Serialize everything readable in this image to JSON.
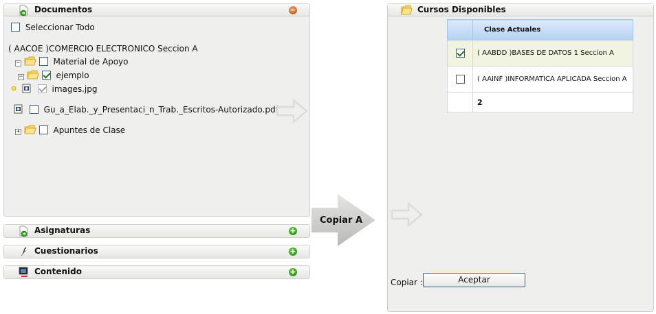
{
  "documents": {
    "title": "Documentos",
    "select_all": "Seleccionar Todo",
    "course_title": "( AACOE )COMERCIO ELECTRONICO Seccion A",
    "tree": [
      {
        "label": "Material de Apoyo",
        "expander": "−",
        "checked": false
      },
      {
        "label": "ejemplo",
        "expander": "−",
        "checked": true
      },
      {
        "label": "images.jpg",
        "checked": true,
        "disabled": true
      },
      {
        "label": "Gu_a_Elab._y_Presentaci_n_Trab._Escritos-Autorizado.pdf",
        "checked": false
      },
      {
        "label": "Apuntes de Clase",
        "expander": "+",
        "checked": false
      }
    ]
  },
  "sections": [
    {
      "title": "Asignaturas",
      "icon": "subjects-icon"
    },
    {
      "title": "Cuestionarios",
      "icon": "quiz-icon"
    },
    {
      "title": "Contenido",
      "icon": "content-icon"
    }
  ],
  "copy_button_label": "Copiar A",
  "courses": {
    "title": "Cursos Disponibles",
    "column_header": "Clase Actuales",
    "rows": [
      {
        "name": "( AABDD )BASES DE DATOS 1 Seccion A",
        "checked": true
      },
      {
        "name": "( AAINF )INFORMATICA APLICADA Seccion A",
        "checked": false
      }
    ],
    "page_number": "2",
    "copy_label": "Copiar :",
    "accept_label": "Aceptar"
  },
  "colors": {
    "panel_bg": "#efefed",
    "header_blue": "#b6d2f2",
    "check_green": "#1a7a1a"
  }
}
